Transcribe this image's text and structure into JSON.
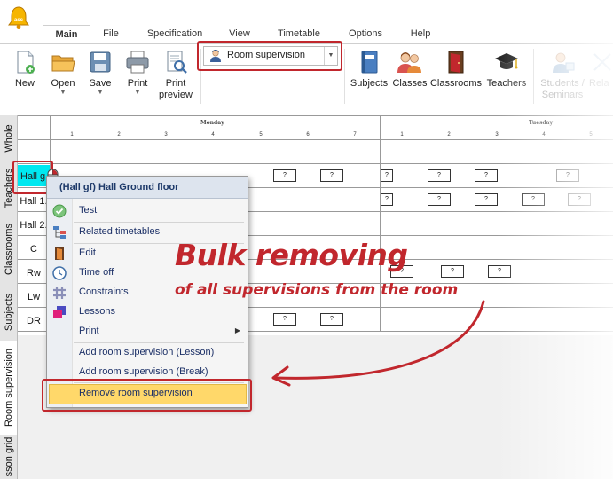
{
  "ribbon": {
    "tabs": [
      "Main",
      "File",
      "Specification",
      "View",
      "Timetable",
      "Options",
      "Help"
    ],
    "buttons": {
      "new": "New",
      "open": "Open",
      "save": "Save",
      "print": "Print",
      "print_preview_1": "Print",
      "print_preview_2": "preview",
      "subjects": "Subjects",
      "classes": "Classes",
      "classrooms": "Classrooms",
      "teachers": "Teachers",
      "students_1": "Students /",
      "students_2": "Seminars",
      "related": "Rela"
    },
    "view_combo": {
      "selected": "Room supervision"
    }
  },
  "side_tabs": [
    "Whole",
    "Teachers",
    "Classrooms",
    "Subjects",
    "Room supervision",
    "sson grid"
  ],
  "grid": {
    "days": [
      "Monday",
      "Tuesday"
    ],
    "monday_periods": [
      "1",
      "2",
      "3",
      "4",
      "5",
      "6",
      "7"
    ],
    "tuesday_periods": [
      "1",
      "2",
      "3",
      "4",
      "5"
    ],
    "rows": [
      "Hall g",
      "Hall 1.",
      "Hall 2.",
      "C",
      "Rw",
      "Lw",
      "DR"
    ],
    "cell_mark": "?"
  },
  "context_menu": {
    "header": "(Hall gf) Hall Ground floor",
    "items": {
      "test": "Test",
      "related_timetables": "Related timetables",
      "edit": "Edit",
      "time_off": "Time off",
      "constraints": "Constraints",
      "lessons": "Lessons",
      "print": "Print",
      "add_lesson": "Add room supervision (Lesson)",
      "add_break": "Add room supervision (Break)",
      "remove": "Remove room supervision"
    },
    "submenu_arrow": "▶"
  },
  "annotation": {
    "title": "Bulk removing",
    "subtitle": "of all supervisions from the room"
  },
  "colors": {
    "accent_red": "#c1272d",
    "selected_cell": "#00e8f0",
    "menu_highlight": "#ffd86a"
  }
}
